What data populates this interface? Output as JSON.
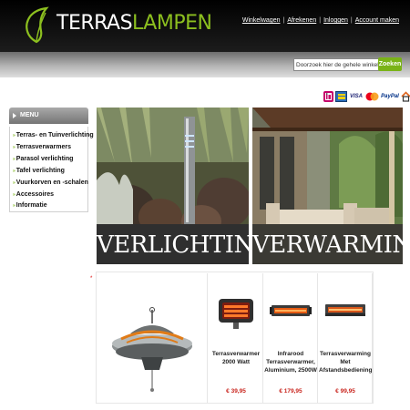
{
  "header": {
    "logo_part1": "TERRAS",
    "logo_part2": "LAMPEN",
    "nav": [
      "Winkelwagen",
      "Afrekenen",
      "Inloggen",
      "Account maken"
    ]
  },
  "search": {
    "value": "Doorzoek hier de gehele winkel...",
    "button_label": "Zoeken"
  },
  "payment_icons": [
    "ideal-icon",
    "bank-transfer-icon",
    "visa-icon",
    "mastercard-icon",
    "paypal-icon",
    "home-icon"
  ],
  "payment_labels": {
    "visa": "VISA",
    "paypal": "PayPal"
  },
  "menu": {
    "title": "MENU",
    "items": [
      "Terras- en Tuinverlichting",
      "Terrasverwarmers",
      "Parasol verlichting",
      "Tafel verlichting",
      "Vuurkorven en -schalen",
      "Accessoires",
      "Informatie"
    ]
  },
  "banners": [
    {
      "caption": "VERLICHTING"
    },
    {
      "caption": "VERWARMING"
    }
  ],
  "products": [
    {
      "name": "Terrasverwarmer 2000 Watt",
      "price": "€ 39,95"
    },
    {
      "name": "Infrarood Terrasverwarmer, Aluminium, 2500W",
      "price": "€ 179,95"
    },
    {
      "name": "Terrasverwarming Met Afstandsbediening",
      "price": "€ 99,95"
    }
  ],
  "colors": {
    "accent": "#7ab317",
    "price": "#c9241d"
  }
}
